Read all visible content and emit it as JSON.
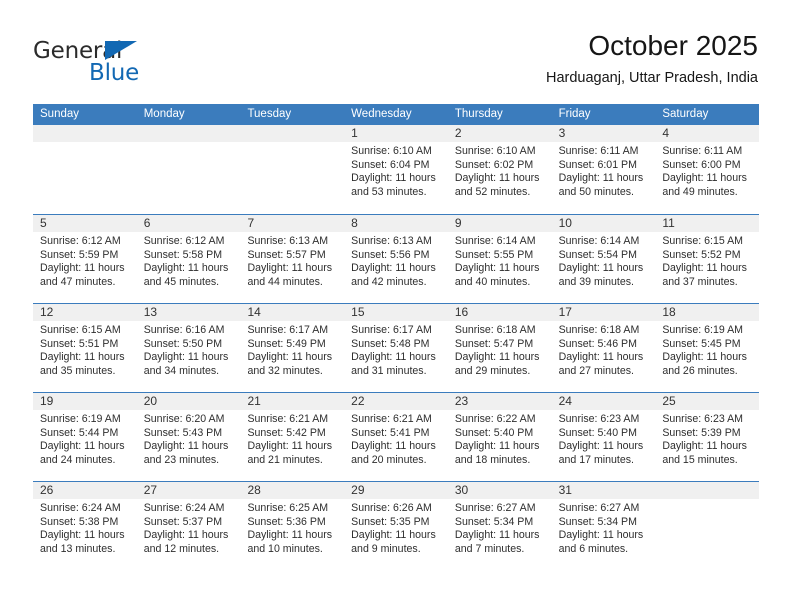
{
  "brand": {
    "name_top": "General",
    "name_bottom": "Blue",
    "accent_color": "#1268b3"
  },
  "header": {
    "title": "October 2025",
    "subtitle": "Harduaganj, Uttar Pradesh, India"
  },
  "theme": {
    "header_band": "#3b7cbd",
    "day_band": "#f0f0f0",
    "text": "#2e2e2e"
  },
  "weekdays": [
    "Sunday",
    "Monday",
    "Tuesday",
    "Wednesday",
    "Thursday",
    "Friday",
    "Saturday"
  ],
  "weeks": [
    [
      {
        "day": "",
        "empty": true
      },
      {
        "day": "",
        "empty": true
      },
      {
        "day": "",
        "empty": true
      },
      {
        "day": "1",
        "sunrise": "Sunrise: 6:10 AM",
        "sunset": "Sunset: 6:04 PM",
        "daylight1": "Daylight: 11 hours",
        "daylight2": "and 53 minutes."
      },
      {
        "day": "2",
        "sunrise": "Sunrise: 6:10 AM",
        "sunset": "Sunset: 6:02 PM",
        "daylight1": "Daylight: 11 hours",
        "daylight2": "and 52 minutes."
      },
      {
        "day": "3",
        "sunrise": "Sunrise: 6:11 AM",
        "sunset": "Sunset: 6:01 PM",
        "daylight1": "Daylight: 11 hours",
        "daylight2": "and 50 minutes."
      },
      {
        "day": "4",
        "sunrise": "Sunrise: 6:11 AM",
        "sunset": "Sunset: 6:00 PM",
        "daylight1": "Daylight: 11 hours",
        "daylight2": "and 49 minutes."
      }
    ],
    [
      {
        "day": "5",
        "sunrise": "Sunrise: 6:12 AM",
        "sunset": "Sunset: 5:59 PM",
        "daylight1": "Daylight: 11 hours",
        "daylight2": "and 47 minutes."
      },
      {
        "day": "6",
        "sunrise": "Sunrise: 6:12 AM",
        "sunset": "Sunset: 5:58 PM",
        "daylight1": "Daylight: 11 hours",
        "daylight2": "and 45 minutes."
      },
      {
        "day": "7",
        "sunrise": "Sunrise: 6:13 AM",
        "sunset": "Sunset: 5:57 PM",
        "daylight1": "Daylight: 11 hours",
        "daylight2": "and 44 minutes."
      },
      {
        "day": "8",
        "sunrise": "Sunrise: 6:13 AM",
        "sunset": "Sunset: 5:56 PM",
        "daylight1": "Daylight: 11 hours",
        "daylight2": "and 42 minutes."
      },
      {
        "day": "9",
        "sunrise": "Sunrise: 6:14 AM",
        "sunset": "Sunset: 5:55 PM",
        "daylight1": "Daylight: 11 hours",
        "daylight2": "and 40 minutes."
      },
      {
        "day": "10",
        "sunrise": "Sunrise: 6:14 AM",
        "sunset": "Sunset: 5:54 PM",
        "daylight1": "Daylight: 11 hours",
        "daylight2": "and 39 minutes."
      },
      {
        "day": "11",
        "sunrise": "Sunrise: 6:15 AM",
        "sunset": "Sunset: 5:52 PM",
        "daylight1": "Daylight: 11 hours",
        "daylight2": "and 37 minutes."
      }
    ],
    [
      {
        "day": "12",
        "sunrise": "Sunrise: 6:15 AM",
        "sunset": "Sunset: 5:51 PM",
        "daylight1": "Daylight: 11 hours",
        "daylight2": "and 35 minutes."
      },
      {
        "day": "13",
        "sunrise": "Sunrise: 6:16 AM",
        "sunset": "Sunset: 5:50 PM",
        "daylight1": "Daylight: 11 hours",
        "daylight2": "and 34 minutes."
      },
      {
        "day": "14",
        "sunrise": "Sunrise: 6:17 AM",
        "sunset": "Sunset: 5:49 PM",
        "daylight1": "Daylight: 11 hours",
        "daylight2": "and 32 minutes."
      },
      {
        "day": "15",
        "sunrise": "Sunrise: 6:17 AM",
        "sunset": "Sunset: 5:48 PM",
        "daylight1": "Daylight: 11 hours",
        "daylight2": "and 31 minutes."
      },
      {
        "day": "16",
        "sunrise": "Sunrise: 6:18 AM",
        "sunset": "Sunset: 5:47 PM",
        "daylight1": "Daylight: 11 hours",
        "daylight2": "and 29 minutes."
      },
      {
        "day": "17",
        "sunrise": "Sunrise: 6:18 AM",
        "sunset": "Sunset: 5:46 PM",
        "daylight1": "Daylight: 11 hours",
        "daylight2": "and 27 minutes."
      },
      {
        "day": "18",
        "sunrise": "Sunrise: 6:19 AM",
        "sunset": "Sunset: 5:45 PM",
        "daylight1": "Daylight: 11 hours",
        "daylight2": "and 26 minutes."
      }
    ],
    [
      {
        "day": "19",
        "sunrise": "Sunrise: 6:19 AM",
        "sunset": "Sunset: 5:44 PM",
        "daylight1": "Daylight: 11 hours",
        "daylight2": "and 24 minutes."
      },
      {
        "day": "20",
        "sunrise": "Sunrise: 6:20 AM",
        "sunset": "Sunset: 5:43 PM",
        "daylight1": "Daylight: 11 hours",
        "daylight2": "and 23 minutes."
      },
      {
        "day": "21",
        "sunrise": "Sunrise: 6:21 AM",
        "sunset": "Sunset: 5:42 PM",
        "daylight1": "Daylight: 11 hours",
        "daylight2": "and 21 minutes."
      },
      {
        "day": "22",
        "sunrise": "Sunrise: 6:21 AM",
        "sunset": "Sunset: 5:41 PM",
        "daylight1": "Daylight: 11 hours",
        "daylight2": "and 20 minutes."
      },
      {
        "day": "23",
        "sunrise": "Sunrise: 6:22 AM",
        "sunset": "Sunset: 5:40 PM",
        "daylight1": "Daylight: 11 hours",
        "daylight2": "and 18 minutes."
      },
      {
        "day": "24",
        "sunrise": "Sunrise: 6:23 AM",
        "sunset": "Sunset: 5:40 PM",
        "daylight1": "Daylight: 11 hours",
        "daylight2": "and 17 minutes."
      },
      {
        "day": "25",
        "sunrise": "Sunrise: 6:23 AM",
        "sunset": "Sunset: 5:39 PM",
        "daylight1": "Daylight: 11 hours",
        "daylight2": "and 15 minutes."
      }
    ],
    [
      {
        "day": "26",
        "sunrise": "Sunrise: 6:24 AM",
        "sunset": "Sunset: 5:38 PM",
        "daylight1": "Daylight: 11 hours",
        "daylight2": "and 13 minutes."
      },
      {
        "day": "27",
        "sunrise": "Sunrise: 6:24 AM",
        "sunset": "Sunset: 5:37 PM",
        "daylight1": "Daylight: 11 hours",
        "daylight2": "and 12 minutes."
      },
      {
        "day": "28",
        "sunrise": "Sunrise: 6:25 AM",
        "sunset": "Sunset: 5:36 PM",
        "daylight1": "Daylight: 11 hours",
        "daylight2": "and 10 minutes."
      },
      {
        "day": "29",
        "sunrise": "Sunrise: 6:26 AM",
        "sunset": "Sunset: 5:35 PM",
        "daylight1": "Daylight: 11 hours",
        "daylight2": "and 9 minutes."
      },
      {
        "day": "30",
        "sunrise": "Sunrise: 6:27 AM",
        "sunset": "Sunset: 5:34 PM",
        "daylight1": "Daylight: 11 hours",
        "daylight2": "and 7 minutes."
      },
      {
        "day": "31",
        "sunrise": "Sunrise: 6:27 AM",
        "sunset": "Sunset: 5:34 PM",
        "daylight1": "Daylight: 11 hours",
        "daylight2": "and 6 minutes."
      },
      {
        "day": "",
        "empty": true
      }
    ]
  ]
}
